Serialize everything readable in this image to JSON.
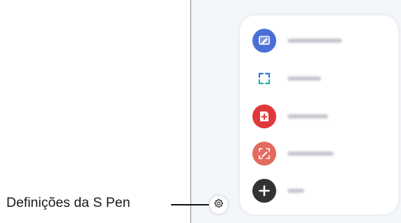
{
  "caption": {
    "label": "Definições da S Pen"
  },
  "menu": {
    "items": [
      {
        "icon": "creative-studio-icon",
        "color": "#4b6fd6",
        "bar_width": 78
      },
      {
        "icon": "ai-select-icon",
        "color": "#2e7bd6",
        "bar_width": 48
      },
      {
        "icon": "create-note-icon",
        "color": "#e0383a",
        "bar_width": 58
      },
      {
        "icon": "screen-write-icon",
        "color": "#e46a5f",
        "bar_width": 66
      },
      {
        "icon": "add-icon",
        "color": "#333333",
        "bar_width": 24
      }
    ]
  },
  "settings": {
    "icon": "gear-icon"
  },
  "colors": {
    "screen_bg": "#f3f6fb",
    "panel_bg": "#ffffff",
    "caption_text": "#1a1a1a"
  }
}
